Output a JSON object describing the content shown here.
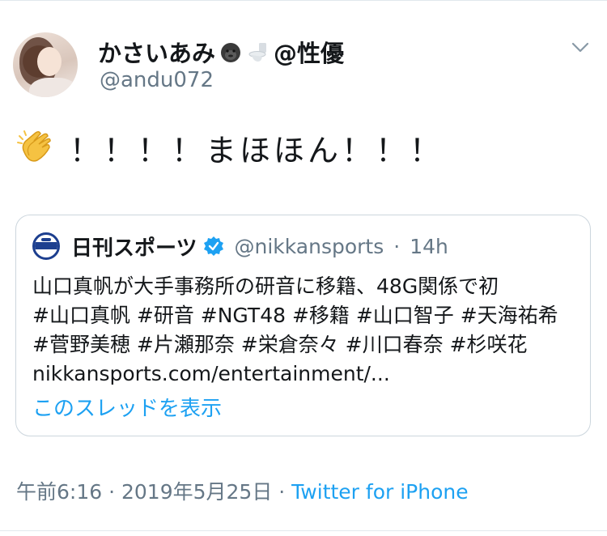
{
  "user": {
    "display_name": "かさいあみ",
    "display_name_suffix": "@性優",
    "handle": "@andu072",
    "emoji_icons": [
      "gorilla-icon",
      "toilet-icon"
    ]
  },
  "tweet": {
    "emoji_icon": "clapping-hands-icon",
    "text": "！！！！まほほん！！！"
  },
  "quote": {
    "account_name": "日刊スポーツ",
    "handle": "@nikkansports",
    "separator": "·",
    "time": "14h",
    "lines": [
      "山口真帆が大手事務所の研音に移籍、48G関係で初",
      "#山口真帆 #研音 #NGT48 #移籍 #山口智子 #天海祐希",
      "#菅野美穂 #片瀬那奈 #栄倉奈々 #川口春奈 #杉咲花",
      "nikkansports.com/entertainment/..."
    ],
    "show_thread": "このスレッドを表示"
  },
  "footer": {
    "time": "午前6:16",
    "separator1": " · ",
    "date": "2019年5月25日",
    "separator2": " · ",
    "source": "Twitter for iPhone"
  },
  "colors": {
    "link": "#1da1f2",
    "secondary_text": "#657786",
    "border": "#ccd6dd",
    "verified": "#1da1f2"
  }
}
